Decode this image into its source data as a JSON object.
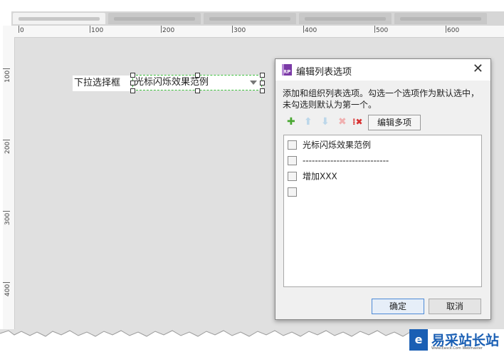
{
  "ruler": {
    "h_labels": [
      "0",
      "100",
      "200",
      "300",
      "400",
      "500",
      "600"
    ],
    "v_labels": [
      "100",
      "200",
      "300",
      "400"
    ]
  },
  "widget": {
    "label": "下拉选择框",
    "selected": "光标闪烁效果范例"
  },
  "dialog": {
    "icon_text": "RP",
    "title": "编辑列表选项",
    "close": "✕",
    "description": "添加和组织列表选项。勾选一个选项作为默认选中，未勾选则默认为第一个。",
    "toolbar": {
      "add": "✚",
      "up": "⬆",
      "down": "⬇",
      "delete": "✖",
      "clear": "⁞✖",
      "edit_multi": "编辑多项"
    },
    "items": [
      "光标闪烁效果范例",
      "----------------------------",
      "增加XXX",
      ""
    ],
    "ok": "确定",
    "cancel": "取消"
  },
  "logo": {
    "mark": "e",
    "text": "易采站长站",
    "sub": "Www.Easck.Com  Webmaster"
  }
}
